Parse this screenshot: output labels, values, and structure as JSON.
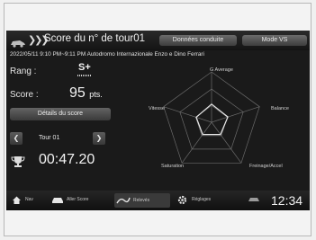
{
  "header": {
    "title": "Score du n° de tour01",
    "tabs": [
      "Données conduite",
      "Mode VS"
    ]
  },
  "session": {
    "info": "2022/05/11 9:10 PM~9:11 PM Autodromo Internazionale Enzo e Dino Ferrari"
  },
  "stats": {
    "rank_label": "Rang :",
    "rank_value": "S+",
    "score_label": "Score :",
    "score_value": "95",
    "score_unit": "pts.",
    "details_button": "Détails du score",
    "lap_label": "Tour 01",
    "lap_time": "00:47.20"
  },
  "radar": {
    "labels": {
      "top": "G Average",
      "left": "Vitesse",
      "right": "Balance",
      "bottom_left": "Saturation",
      "bottom_right": "Freinage/Accel"
    },
    "values": [
      0.36,
      0.34,
      0.3,
      0.3,
      0.32
    ]
  },
  "bottom_nav": {
    "items": [
      "Nav",
      "Aller Score",
      "Relevés",
      "Réglages"
    ],
    "clock": "12:34"
  },
  "colors": {
    "screen_bg": "#1a1a1a",
    "button_top": "#636363",
    "button_bottom": "#3a3a3a",
    "text": "#e6e6e6"
  }
}
